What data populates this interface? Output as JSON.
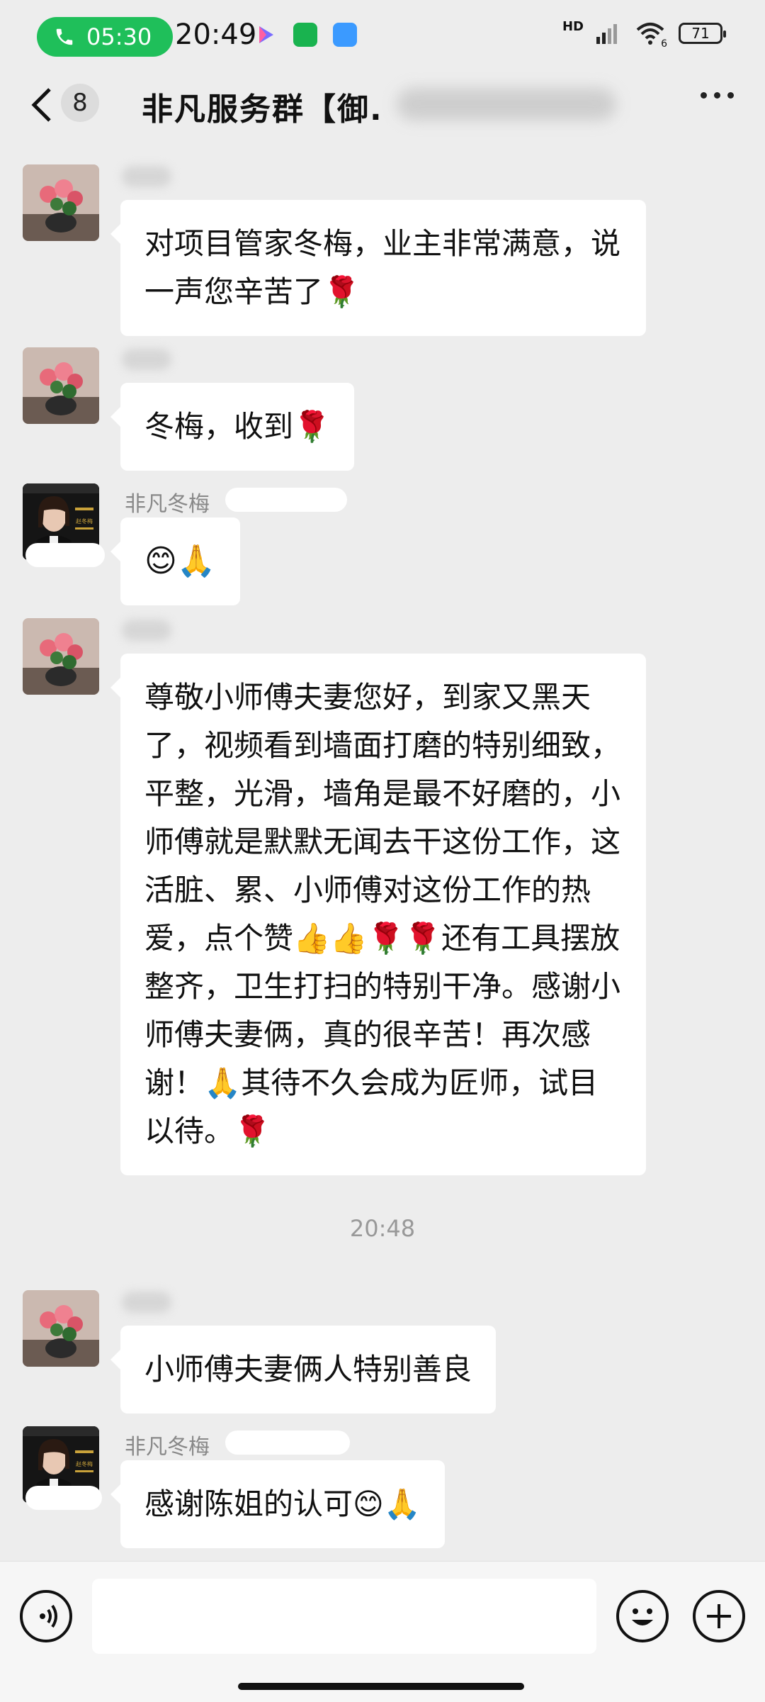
{
  "status_bar": {
    "call_time": "05:30",
    "clock": "20:49",
    "network": "HD",
    "battery": "71",
    "wifi_badge": "6"
  },
  "header": {
    "unread_count": "8",
    "title": "非凡服务群【御."
  },
  "messages": [
    {
      "sender": "",
      "text": "对项目管家冬梅，业主非常满意，说一声您辛苦了🌹"
    },
    {
      "sender": "",
      "text": "冬梅，收到🌹"
    },
    {
      "sender": "非凡冬梅",
      "text": "😊🙏"
    },
    {
      "sender": "",
      "text": "尊敬小师傅夫妻您好，到家又黑天了，视频看到墙面打磨的特别细致，平整，光滑，墙角是最不好磨的，小师傅就是默默无闻去干这份工作，这活脏、累、小师傅对这份工作的热爱，点个赞👍👍🌹🌹还有工具摆放整齐，卫生打扫的特别干净。感谢小师傅夫妻俩，真的很辛苦！再次感谢！🙏其待不久会成为匠师，试目以待。🌹"
    },
    {
      "sender": "",
      "text": "小师傅夫妻俩人特别善良"
    },
    {
      "sender": "非凡冬梅",
      "text": "感谢陈姐的认可😊🙏"
    }
  ],
  "timestamp": "20:48",
  "input_bar": {
    "placeholder": ""
  },
  "avatar_person_label": "赵冬梅",
  "colors": {
    "accent_green": "#1fbf5a",
    "background": "#ededed",
    "bubble": "#ffffff"
  }
}
